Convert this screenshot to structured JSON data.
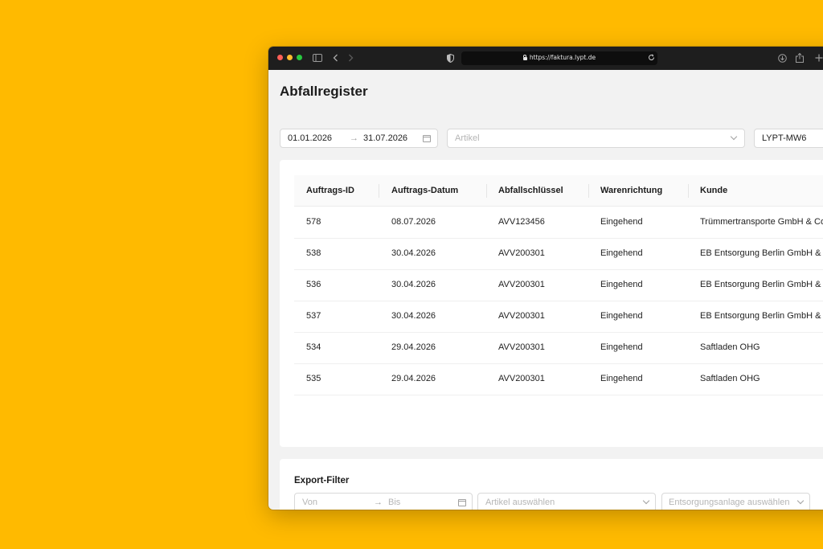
{
  "colors": {
    "background": "#FFBA00",
    "accent": "#FFBA00",
    "traffic_red": "#FF5F57",
    "traffic_yellow": "#FEBC2E",
    "traffic_green": "#28C840"
  },
  "browser": {
    "url": "https://faktura.lypt.de",
    "icons": [
      "sidebar-icon",
      "back-icon",
      "forward-icon",
      "shield-icon",
      "lock-icon",
      "reload-icon",
      "download-icon",
      "share-icon",
      "new-tab-icon"
    ]
  },
  "page": {
    "title": "Abfallregister"
  },
  "filters": {
    "date_from": "01.01.2026",
    "date_to": "31.07.2026",
    "date_separator": "→",
    "article_placeholder": "Artikel",
    "site_value": "LYPT-MW6"
  },
  "table": {
    "columns": [
      "Auftrags-ID",
      "Auftrags-Datum",
      "Abfallschlüssel",
      "Warenrichtung",
      "Kunde"
    ],
    "rows": [
      [
        "578",
        "08.07.2026",
        "AVV123456",
        "Eingehend",
        "Trümmertransporte GmbH & Co"
      ],
      [
        "538",
        "30.04.2026",
        "AVV200301",
        "Eingehend",
        "EB Entsorgung Berlin GmbH & C"
      ],
      [
        "536",
        "30.04.2026",
        "AVV200301",
        "Eingehend",
        "EB Entsorgung Berlin GmbH & C"
      ],
      [
        "537",
        "30.04.2026",
        "AVV200301",
        "Eingehend",
        "EB Entsorgung Berlin GmbH & C"
      ],
      [
        "534",
        "29.04.2026",
        "AVV200301",
        "Eingehend",
        "Saftladen OHG"
      ],
      [
        "535",
        "29.04.2026",
        "AVV200301",
        "Eingehend",
        "Saftladen OHG"
      ]
    ]
  },
  "export": {
    "title": "Export-Filter",
    "from_placeholder": "Von",
    "to_placeholder": "Bis",
    "date_separator": "→",
    "article_placeholder": "Artikel auswählen",
    "facility_placeholder": "Entsorgungsanlage auswählen"
  }
}
